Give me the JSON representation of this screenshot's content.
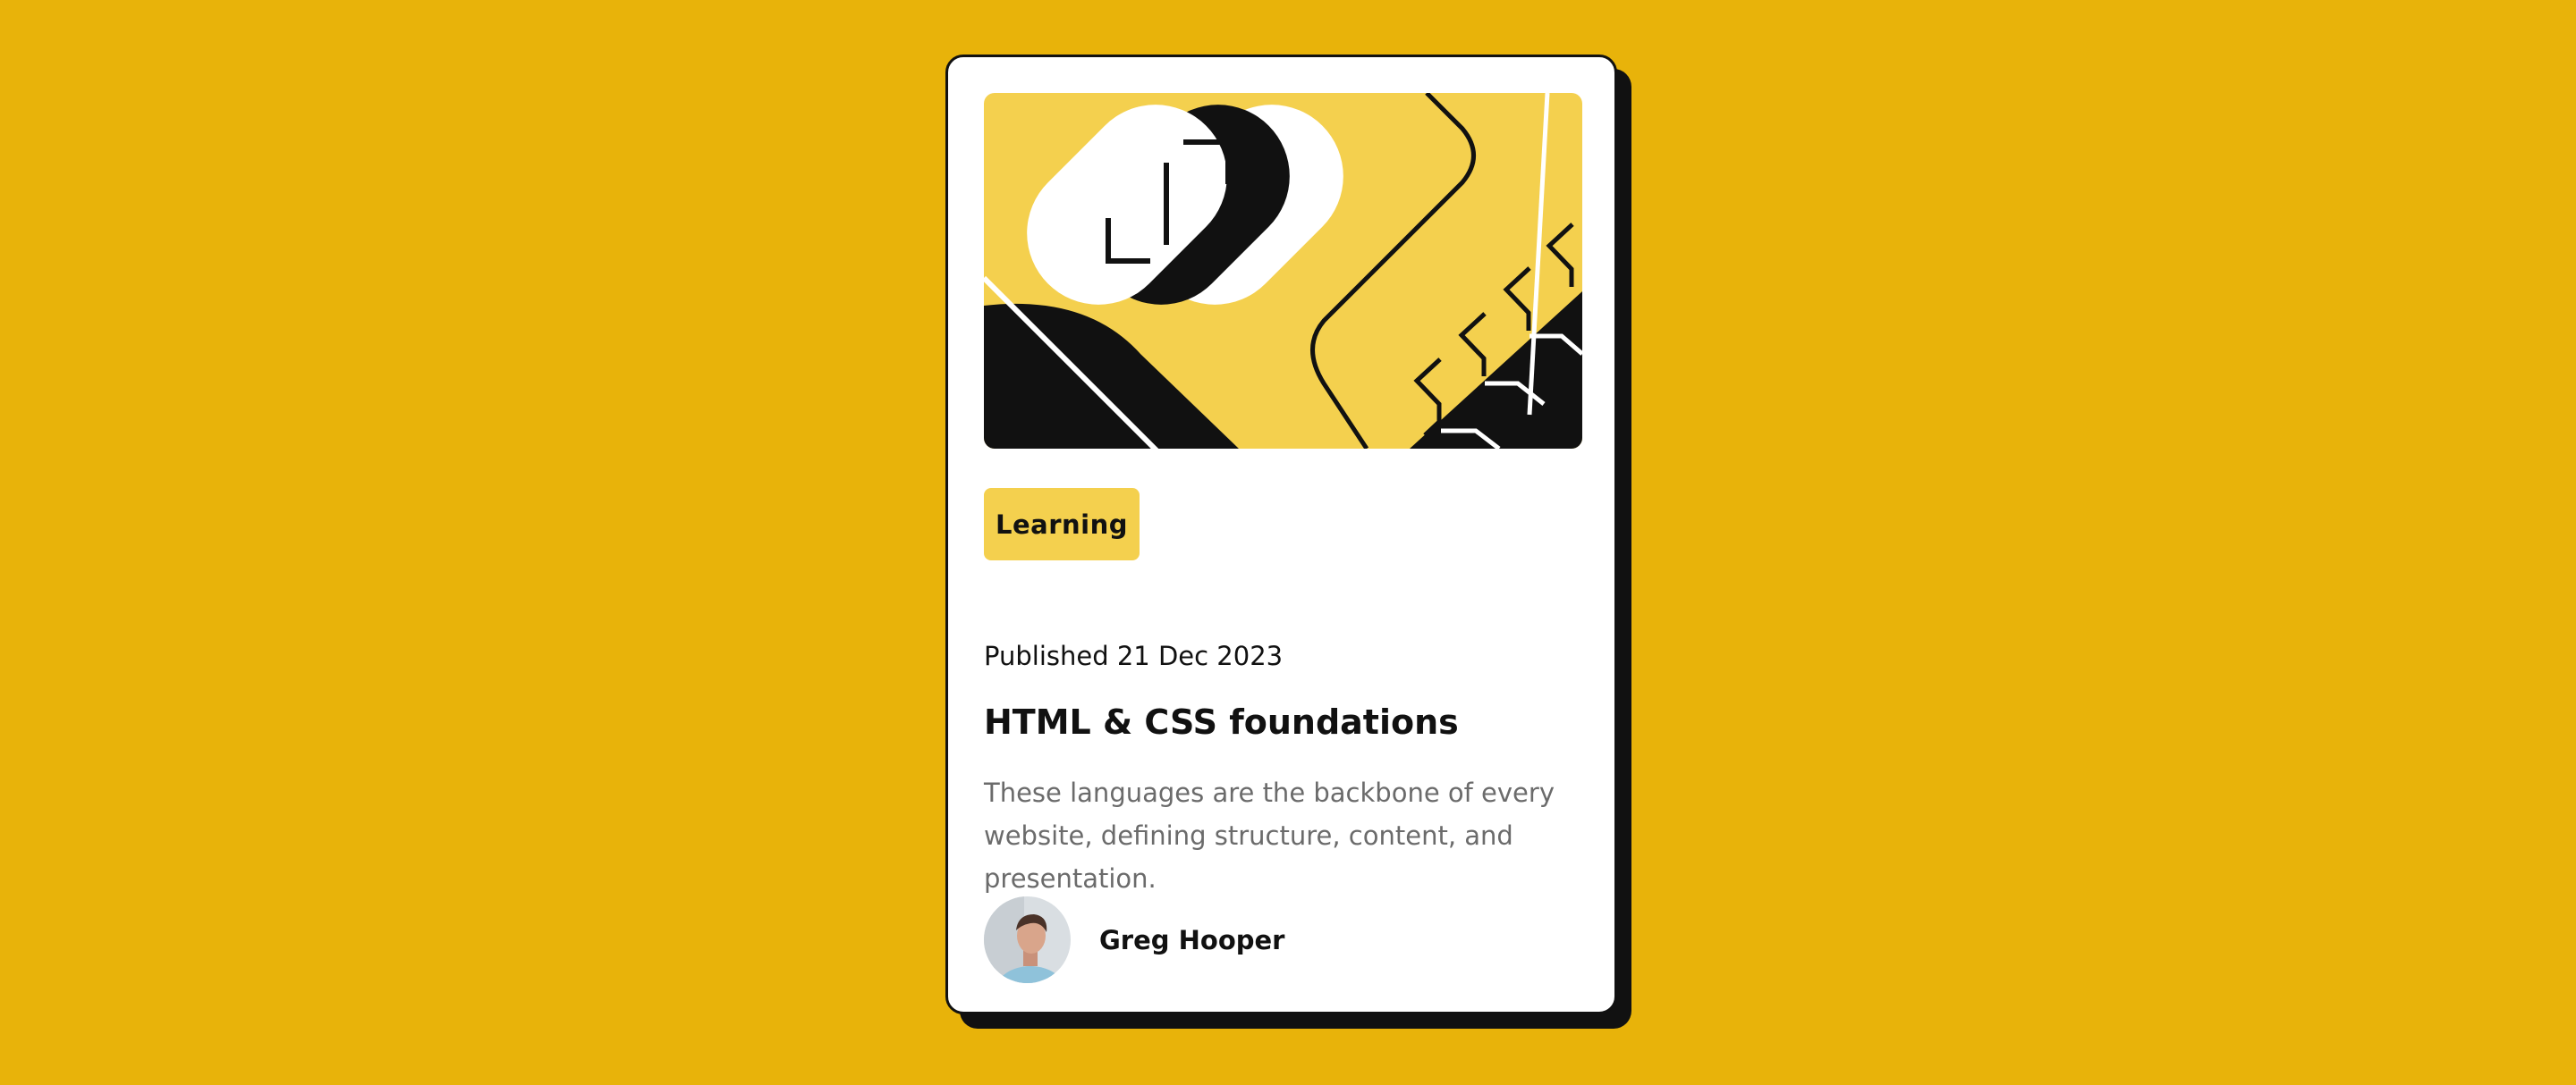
{
  "card": {
    "hero_image": "html-css-foundations-illustration",
    "category": "Learning",
    "published": "Published 21 Dec 2023",
    "title": "HTML & CSS foundations",
    "description": "These languages are the backbone of every website, defining structure, content, and presentation.",
    "author": {
      "name": "Greg Hooper",
      "avatar": "author-portrait"
    }
  },
  "colors": {
    "page_background": "#E8B30A",
    "card_background": "#FFFFFF",
    "card_border": "#111111",
    "accent_yellow": "#F4D04E",
    "text_primary": "#111111",
    "text_secondary": "#6B6B6B"
  }
}
